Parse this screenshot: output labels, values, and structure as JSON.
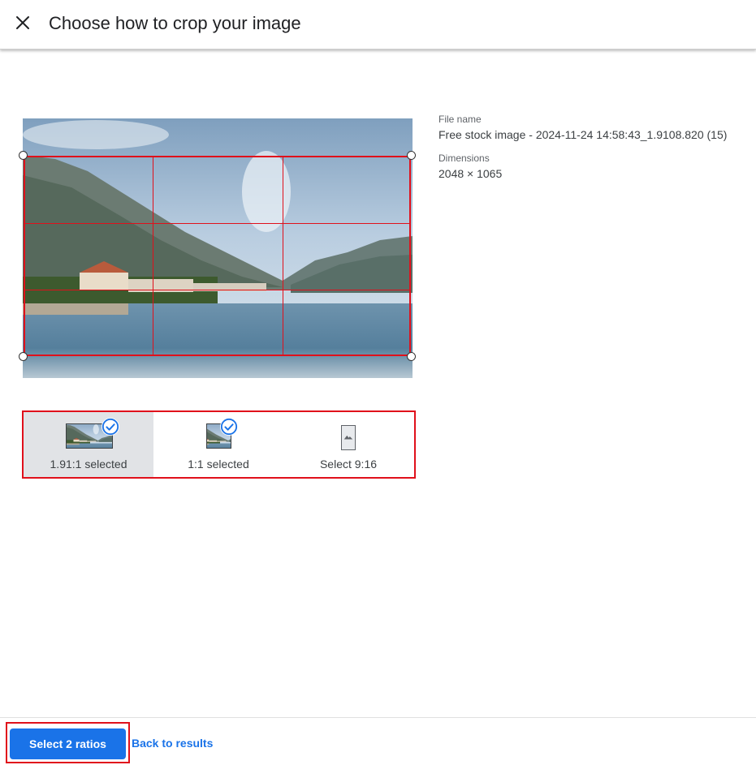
{
  "header": {
    "title": "Choose how to crop your image",
    "close_icon": "close-icon"
  },
  "details": {
    "file_name_label": "File name",
    "file_name": "Free stock image - 2024-11-24 14:58:43_1.9108.820 (15)",
    "dimensions_label": "Dimensions",
    "dimensions": "2048 × 1065"
  },
  "crop": {
    "selected_ratio": "1.91:1"
  },
  "ratios": [
    {
      "label": "1.91:1 selected",
      "selected": true
    },
    {
      "label": "1:1 selected",
      "selected": true
    },
    {
      "label": "Select 9:16",
      "selected": false
    }
  ],
  "footer": {
    "primary_label": "Select 2 ratios",
    "secondary_label": "Back to results"
  },
  "colors": {
    "accent": "#1a73e8",
    "highlight": "#e0101b",
    "selected_bg": "#e1e3e6"
  }
}
